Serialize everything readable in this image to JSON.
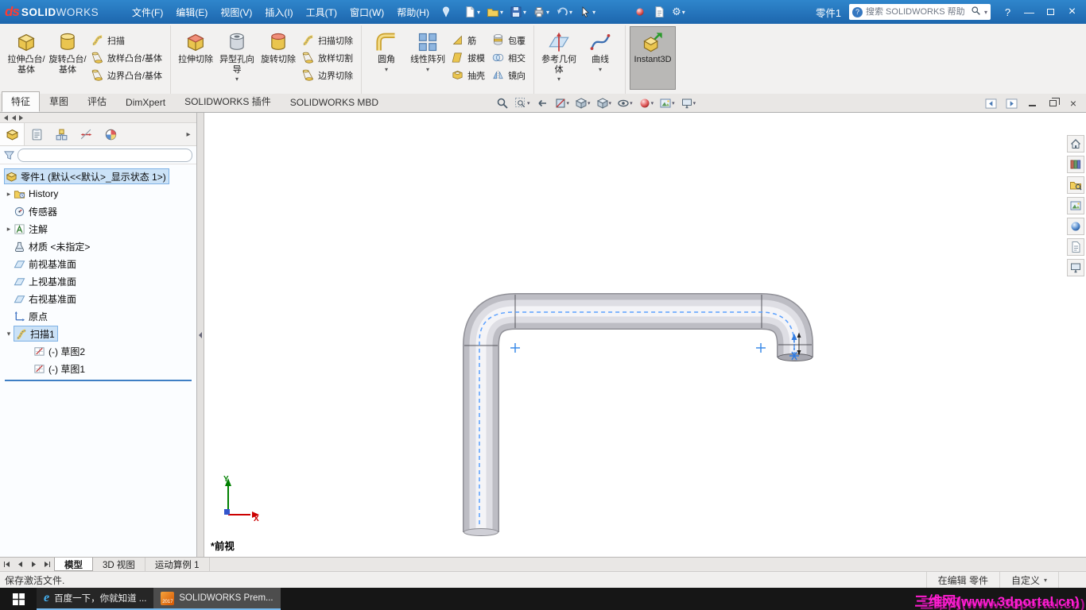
{
  "icons": {
    "caret": "▾",
    "expand_arrow": "▸",
    "collapse_arrow": "▾",
    "help": "?",
    "close": "×",
    "minimize": "—",
    "ie": "e",
    "overflow_arrow": "▸",
    "gear": "⚙"
  },
  "title_bar": {
    "logo_mark": "ds",
    "brand_bold": "SOLID",
    "brand_light": "WORKS",
    "menus": [
      "文件(F)",
      "编辑(E)",
      "视图(V)",
      "插入(I)",
      "工具(T)",
      "窗口(W)",
      "帮助(H)"
    ],
    "document_title": "零件1",
    "search_placeholder": "搜索 SOLIDWORKS 帮助"
  },
  "ribbon": {
    "tabs": [
      "特征",
      "草图",
      "评估",
      "DimXpert",
      "SOLIDWORKS 插件",
      "SOLIDWORKS MBD"
    ],
    "g1": {
      "bigs": [
        "拉伸凸台/基体",
        "旋转凸台/基体"
      ],
      "smalls": [
        "扫描",
        "放样凸台/基体",
        "边界凸台/基体"
      ]
    },
    "g2": {
      "bigs": [
        "拉伸切除",
        "异型孔向导",
        "旋转切除"
      ],
      "smalls": [
        "扫描切除",
        "放样切割",
        "边界切除"
      ]
    },
    "g3": {
      "bigs": [
        "圆角",
        "线性阵列"
      ],
      "smalls1": [
        "筋",
        "拔模",
        "抽壳"
      ],
      "smalls2": [
        "包覆",
        "相交",
        "镜向"
      ]
    },
    "g4": {
      "bigs": [
        "参考几何体",
        "曲线"
      ]
    },
    "instant3d": "Instant3D"
  },
  "feature_tree": {
    "root_label": "零件1 (默认<<默认>_显示状态 1>)",
    "items": [
      "History",
      "传感器",
      "注解",
      "材质 <未指定>",
      "前视基准面",
      "上视基准面",
      "右视基准面",
      "原点",
      "扫描1",
      "(-) 草图2",
      "(-) 草图1"
    ]
  },
  "viewport": {
    "view_label": "*前视",
    "axis_x": "X",
    "axis_y": "Y"
  },
  "sheet_tabs": [
    "模型",
    "3D 视图",
    "运动算例 1"
  ],
  "status_bar": {
    "message": "保存激活文件.",
    "mode": "在编辑 零件",
    "custom": "自定义"
  },
  "taskbar": {
    "buttons": [
      {
        "label": "百度一下，你就知道 ..."
      },
      {
        "label": "SOLIDWORKS Prem...",
        "icon_year": "2017"
      }
    ],
    "watermark": "三维网(www.3dportal.cn)"
  }
}
